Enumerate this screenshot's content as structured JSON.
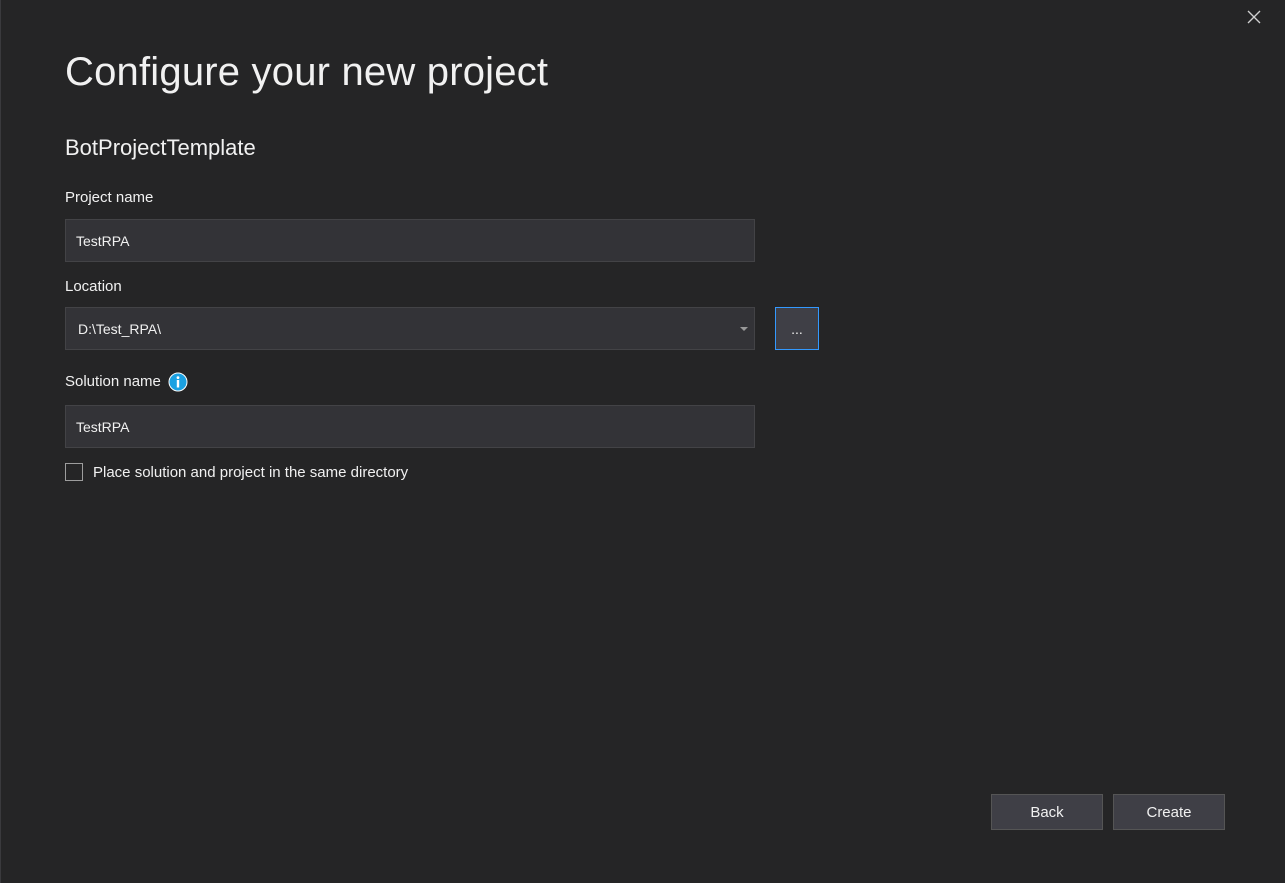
{
  "dialog": {
    "title": "Configure your new project",
    "template_name": "BotProjectTemplate",
    "close_icon": "close-icon"
  },
  "project_name": {
    "label": "Project name",
    "value": "TestRPA"
  },
  "location": {
    "label": "Location",
    "value": "D:\\Test_RPA\\",
    "browse_label": "..."
  },
  "solution_name": {
    "label": "Solution name",
    "value": "TestRPA",
    "info_icon": "info-icon"
  },
  "same_directory": {
    "label": "Place solution and project in the same directory",
    "checked": false
  },
  "footer": {
    "back_label": "Back",
    "create_label": "Create"
  },
  "colors": {
    "background": "#252526",
    "input_background": "#333337",
    "accent": "#3399ff",
    "info": "#1ba1e2"
  }
}
